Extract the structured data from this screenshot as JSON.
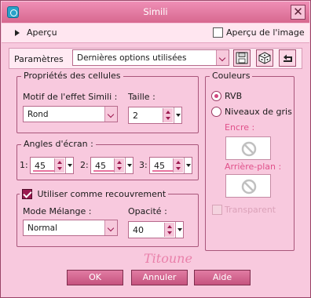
{
  "window": {
    "title": "Simili"
  },
  "apercu": {
    "label": "Aperçu",
    "image_checkbox_label": "Aperçu de l'image"
  },
  "parametres": {
    "label": "Paramètres",
    "preset_value": "Dernières options utilisées"
  },
  "cell_props": {
    "title": "Propriétés des cellules",
    "motif_label": "Motif de l'effet Simili :",
    "motif_value": "Rond",
    "taille_label": "Taille :",
    "taille_value": "2"
  },
  "angles": {
    "title": "Angles d'écran :",
    "items": [
      {
        "label": "1:",
        "value": "45"
      },
      {
        "label": "2:",
        "value": "45"
      },
      {
        "label": "3:",
        "value": "45"
      }
    ]
  },
  "overlay": {
    "title": "Utiliser comme recouvrement",
    "mode_label": "Mode Mélange :",
    "mode_value": "Normal",
    "opacity_label": "Opacité :",
    "opacity_value": "40"
  },
  "couleurs": {
    "title": "Couleurs",
    "rvb_label": "RVB",
    "gris_label": "Niveaux de gris",
    "encre_label": "Encre :",
    "arriere_label": "Arrière-plan :",
    "transparent_label": "Transparent"
  },
  "watermark": "Titoune",
  "buttons": {
    "ok": "OK",
    "annuler": "Annuler",
    "aide": "Aide"
  },
  "colors": {
    "title_bar": "#e07aa2",
    "dialog_bg": "#f8c9de",
    "accent": "#9b1a4f"
  }
}
